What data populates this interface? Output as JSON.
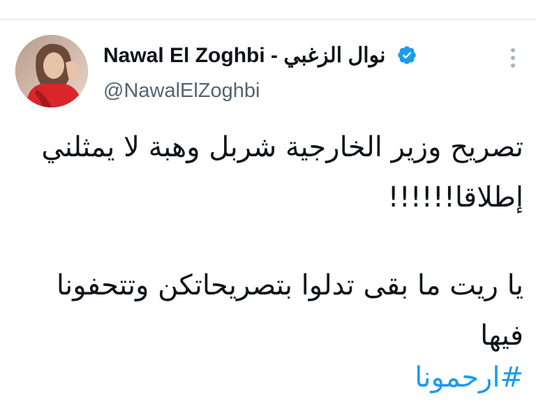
{
  "tweet": {
    "author": {
      "display_name": "Nawal El Zoghbi - نوال الزغبي",
      "handle": "@NawalElZoghbi",
      "verified": true,
      "avatar_icon": "profile-photo"
    },
    "text_lines": [
      "تصريح وزير الخارجية شربل وهبة لا يمثلني",
      "إطلاقا!!!!!!",
      "يا ريت ما بقى تدلوا بتصريحاتكن وتتحفونا",
      "فيها"
    ],
    "hashtag": "#ارحمونا",
    "colors": {
      "link": "#1d9bf0",
      "secondary_text": "#536471",
      "primary_text": "#0f1419",
      "verified_badge": "#1d9bf0"
    },
    "icons": {
      "verified": "verified-badge-icon",
      "more": "more-options-icon"
    }
  }
}
